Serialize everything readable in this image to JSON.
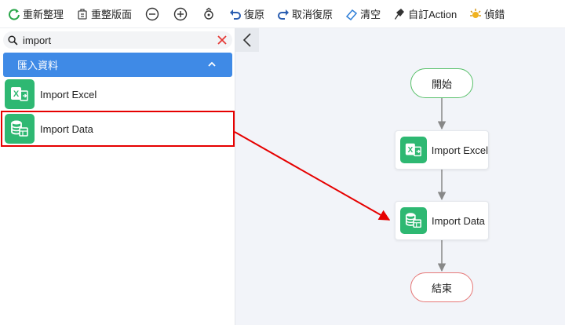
{
  "toolbar": {
    "refresh": "重新整理",
    "relayout": "重整版面",
    "undo": "復原",
    "redo": "取消復原",
    "clear": "清空",
    "custom_action": "自訂Action",
    "debug": "偵錯"
  },
  "search": {
    "value": "import"
  },
  "group": {
    "label": "匯入資料"
  },
  "sidebar_items": [
    {
      "label": "Import Excel",
      "icon": "excel-icon"
    },
    {
      "label": "Import Data",
      "icon": "database-icon"
    }
  ],
  "flow": {
    "start": "開始",
    "nodes": [
      {
        "label": "Import Excel",
        "icon": "excel-icon"
      },
      {
        "label": "Import Data",
        "icon": "database-icon"
      }
    ],
    "end": "結束"
  },
  "colors": {
    "accent": "#3f8ae6",
    "node_icon_green": "#2eb872",
    "highlight_red": "#e60000",
    "start_border": "#58c06a",
    "end_border": "#e67878"
  }
}
